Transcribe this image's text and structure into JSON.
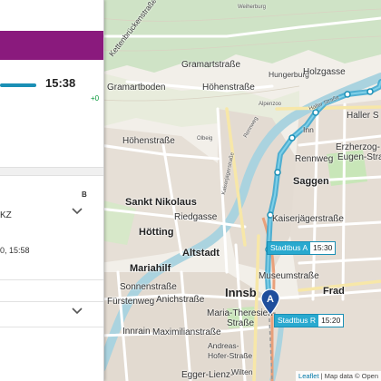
{
  "panel": {
    "departure_time": "15:38",
    "delay": "+0",
    "header_b": "B",
    "line_name": "KZ",
    "departure_info": "0, 15:58"
  },
  "map": {
    "labels": {
      "gramartstrasse": "Gramartstraße",
      "hungerburg": "Hungerburg",
      "holzgasse": "Holzgasse",
      "kettenbrueckenstrasse": "Kettenbrückenstraße",
      "gramartboden": "Gramartboden",
      "hoehenstrasse1": "Höhenstraße",
      "hoehenstrasse2": "Höhenstraße",
      "alpenzoo": "Alpenzoo",
      "olbeig": "Olbeig",
      "haller_strasse": "Haller Straße",
      "haller_s": "Haller S",
      "erzherzog": "Erzherzog-",
      "eugen": "Eugen-Straße",
      "rennweg": "Rennweg",
      "saggen": "Saggen",
      "sankt_nikolaus": "Sankt Nikolaus",
      "riedgasse": "Riedgasse",
      "hoetting": "Hötting",
      "kaiserjaegerstrasse": "Kaiserjägerstraße",
      "altstadt": "Altstadt",
      "mariahilf": "Mariahilf",
      "sonnenstrasse": "Sonnenstraße",
      "museumstrasse": "Museumstraße",
      "innsbruck": "Innsb",
      "fuerstenweg": "Fürstenweg",
      "anichstrasse": "Anichstraße",
      "frad": "Frad",
      "maria_theresien": "Maria-Theresien-",
      "strasse": "Straße",
      "innrain": "Innrain",
      "maximilianstrasse": "Maximilianstraße",
      "andreas_hofer": "Andreas-",
      "hofer_strasse": "Hofer-Straße",
      "egger_lienz": "Egger-Lienz-",
      "wilten": "Wilten",
      "inn": "Inn",
      "rennweg_diag": "Rennweg",
      "kaiserjaeger_small": "Kaiserjägerstraße",
      "haller_small": "Haller Straße",
      "roemerweg": "Weiherburg"
    },
    "stops": [
      {
        "name": "Stadtbus A",
        "time": "15:30"
      },
      {
        "name": "Stadtbus R",
        "time": "15:20"
      }
    ],
    "marker_letter": "A",
    "attribution_leaflet": "Leaflet",
    "attribution_rest": " | Map data © Open"
  },
  "colors": {
    "route": "#4fb7d8",
    "route_dark": "#1a8fb5",
    "panel_accent": "#8a1a7d",
    "river": "#aad3df",
    "delay_green": "#0a9a3c"
  }
}
